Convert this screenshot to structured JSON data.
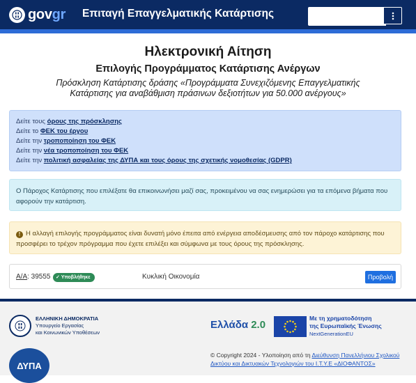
{
  "header": {
    "logo_text_a": "gov",
    "logo_text_b": "gr",
    "title": "Επιταγή Επαγγελματικής Κατάρτισης",
    "menu_icon": "kebab-vertical-icon"
  },
  "page": {
    "title": "Ηλεκτρονική Αίτηση",
    "subtitle": "Επιλογής Προγράμματος Κατάρτισης Ανέργων",
    "description": "Πρόσκληση Κατάρτισης δράσης «Προγράμματα Συνεχιζόμενης Επαγγελματικής Κατάρτισης για αναβάθμιση πράσινων δεξιοτήτων για 50.000 ανέργους»"
  },
  "links": [
    {
      "prefix": "Δείτε τους ",
      "label": "όρους της πρόσκλησης"
    },
    {
      "prefix": "Δείτε το ",
      "label": "ΦΕΚ του έργου"
    },
    {
      "prefix": "Δείτε την ",
      "label": "τροποποίηση του ΦΕΚ"
    },
    {
      "prefix": "Δείτε την ",
      "label": "νέα τροποποίηση του ΦΕΚ"
    },
    {
      "prefix": "Δείτε την ",
      "label": "πολιτική ασφαλείας της ΔΥΠΑ και τους όρους της σχετικής νομοθεσίας (GDPR)"
    }
  ],
  "info_text": "Ο Πάροχος Κατάρτισης που επιλέξατε θα επικοινωνήσει μαζί σας, προκειμένου να σας ενημερώσει για τα επόμενα βήματα που αφορούν την κατάρτιση.",
  "warning_text": "Η αλλαγή επιλογής προγράμματος είναι δυνατή μόνο έπειτα από ενέργεια αποδέσμευσης από τον πάροχο κατάρτισης που προσφέρει το τρέχον πρόγραμμα που έχετε επιλέξει και σύμφωνα με τους όρους της πρόσκλησης.",
  "program_row": {
    "aa_label": "Α/Α",
    "aa_value": ": 39555",
    "status": "Υποβλήθηκε",
    "name": "Κυκλική Οικονομία",
    "view_button": "Προβολή"
  },
  "footer": {
    "ministry_line1": "ΕΛΛΗΝΙΚΗ ΔΗΜΟΚΡΑΤΙΑ",
    "ministry_line2": "Υπουργείο Εργασίας",
    "ministry_line3": "και Κοινωνικών Υποθέσεων",
    "dypa": "ΔΥΠΑ",
    "ellada_a": "Ελλάδα",
    "ellada_b": "2.0",
    "eu_line1": "Με τη χρηματοδότηση",
    "eu_line2": "της Ευρωπαϊκής Ένωσης",
    "eu_line3": "NextGenerationEU",
    "copyright_prefix": "© Copyright 2024 - Υλοποίηση από τη ",
    "copyright_link": "Διεύθυνση Πανελλήνιου Σχολικού Δικτύου και Δικτυακών Τεχνολογιών του Ι.Τ.Υ.Ε «ΔΙΟΦΑΝΤΟΣ»"
  }
}
